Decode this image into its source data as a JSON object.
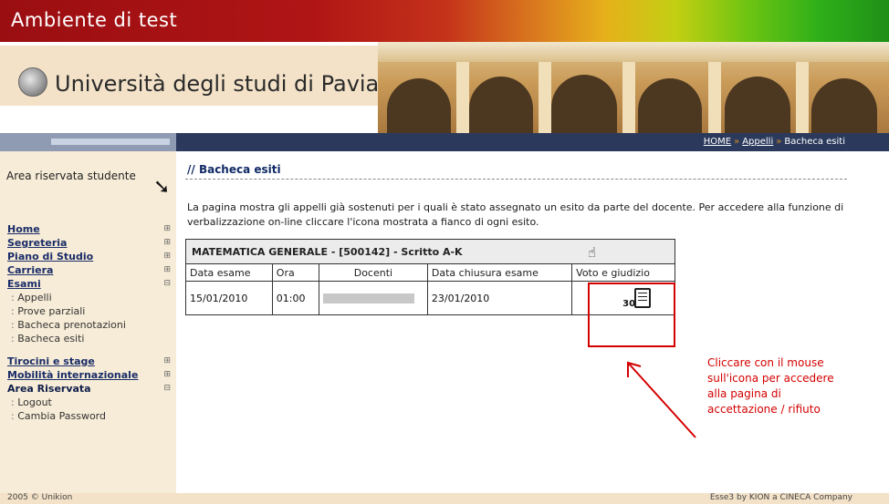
{
  "banner": {
    "title": "Ambiente di test"
  },
  "header": {
    "university_name": "Università degli studi di Pavia"
  },
  "breadcrumb": {
    "home": "HOME",
    "second": "Appelli",
    "current": "Bacheca esiti",
    "separator": "»"
  },
  "sidebar": {
    "area_title": "Area riservata studente",
    "items": [
      {
        "label": "Home",
        "type": "main"
      },
      {
        "label": "Segreteria",
        "type": "main"
      },
      {
        "label": "Piano di Studio",
        "type": "main"
      },
      {
        "label": "Carriera",
        "type": "main"
      },
      {
        "label": "Esami",
        "type": "main"
      },
      {
        "label": "Appelli",
        "type": "sub"
      },
      {
        "label": "Prove parziali",
        "type": "sub"
      },
      {
        "label": "Bacheca prenotazioni",
        "type": "sub"
      },
      {
        "label": "Bacheca esiti",
        "type": "sub"
      },
      {
        "label": "Tirocini e stage",
        "type": "main"
      },
      {
        "label": "Mobilità internazionale",
        "type": "main"
      },
      {
        "label": "Area Riservata",
        "type": "main"
      },
      {
        "label": "Logout",
        "type": "sub"
      },
      {
        "label": "Cambia Password",
        "type": "sub"
      }
    ]
  },
  "main": {
    "title": "// Bacheca esiti",
    "intro": "La pagina mostra gli appelli già sostenuti per i quali è stato assegnato un esito da parte del docente. Per accedere alla funzione di verbalizzazione on-line cliccare l'icona mostrata a fianco di ogni esito.",
    "course": "MATEMATICA GENERALE - [500142] - Scritto A-K",
    "columns": [
      "Data esame",
      "Ora",
      "Docenti",
      "Data chiusura esame",
      "Voto e giudizio"
    ],
    "row": {
      "data_esame": "15/01/2010",
      "ora": "01:00",
      "docenti": "",
      "data_chiusura": "23/01/2010",
      "voto": "30"
    }
  },
  "annotation": {
    "callout": "Cliccare con il mouse sull'icona per accedere alla pagina di accettazione / rifiuto",
    "color": "#d40000"
  },
  "footer": {
    "left": "2005 © Unikion",
    "right": "Esse3 by KION a CINECA Company"
  }
}
